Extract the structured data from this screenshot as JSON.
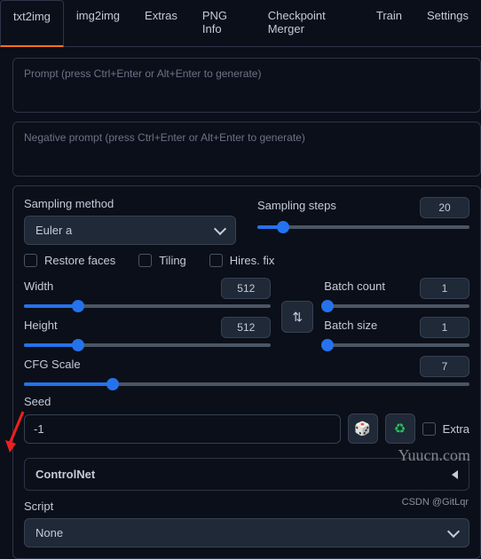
{
  "tabs": [
    "txt2img",
    "img2img",
    "Extras",
    "PNG Info",
    "Checkpoint Merger",
    "Train",
    "Settings"
  ],
  "active_tab": "txt2img",
  "prompt": {
    "placeholder": "Prompt (press Ctrl+Enter or Alt+Enter to generate)"
  },
  "negative": {
    "placeholder": "Negative prompt (press Ctrl+Enter or Alt+Enter to generate)"
  },
  "sampling_method": {
    "label": "Sampling method",
    "value": "Euler a"
  },
  "sampling_steps": {
    "label": "Sampling steps",
    "value": "20",
    "fill_pct": 12
  },
  "checks": {
    "restore": "Restore faces",
    "tiling": "Tiling",
    "hires": "Hires. fix"
  },
  "width": {
    "label": "Width",
    "value": "512",
    "fill_pct": 22
  },
  "height": {
    "label": "Height",
    "value": "512",
    "fill_pct": 22
  },
  "batch_count": {
    "label": "Batch count",
    "value": "1",
    "fill_pct": 2
  },
  "batch_size": {
    "label": "Batch size",
    "value": "1",
    "fill_pct": 2
  },
  "cfg": {
    "label": "CFG Scale",
    "value": "7",
    "fill_pct": 20
  },
  "seed": {
    "label": "Seed",
    "value": "-1"
  },
  "extra_label": "Extra",
  "controlnet_label": "ControlNet",
  "script": {
    "label": "Script",
    "value": "None"
  },
  "watermark": "Yuucn.com",
  "credit": "CSDN @GitLqr",
  "icons": {
    "swap": "⇅",
    "dice": "🎲",
    "recycle": "♻"
  }
}
